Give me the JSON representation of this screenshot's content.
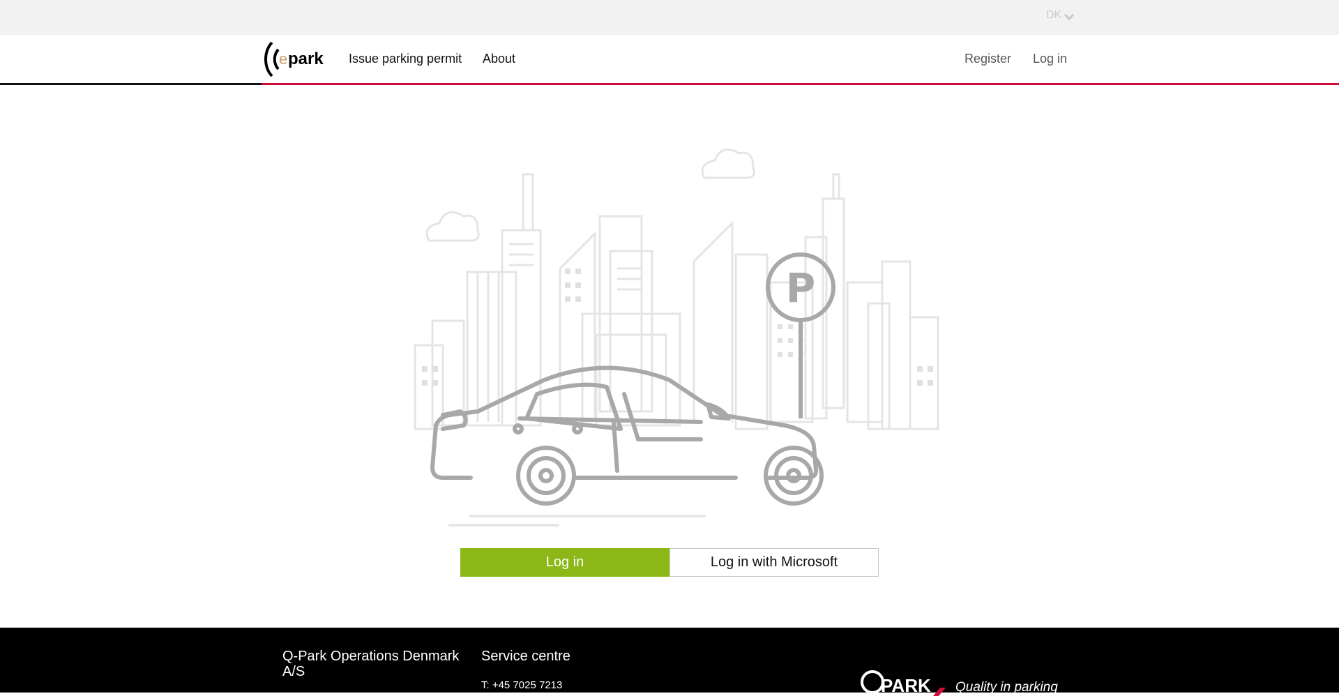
{
  "topbar": {
    "language": "DK"
  },
  "nav": {
    "logo_alt": "epark",
    "links": [
      "Issue parking permit",
      "About"
    ],
    "right_links": [
      "Register",
      "Log in"
    ]
  },
  "illustration": {
    "parking_sign": "P"
  },
  "actions": {
    "login_label": "Log in",
    "ms_login_label": "Log in with Microsoft"
  },
  "footer": {
    "company": "Q-Park Operations Denmark A/S",
    "service_title": "Service centre",
    "phone": "T: +45 7025 7213",
    "brand": "Q PARK",
    "tagline": "Quality in parking"
  },
  "colors": {
    "accent_green": "#8cb817",
    "brand_red": "#d0103a",
    "footer_bg": "#000000"
  }
}
